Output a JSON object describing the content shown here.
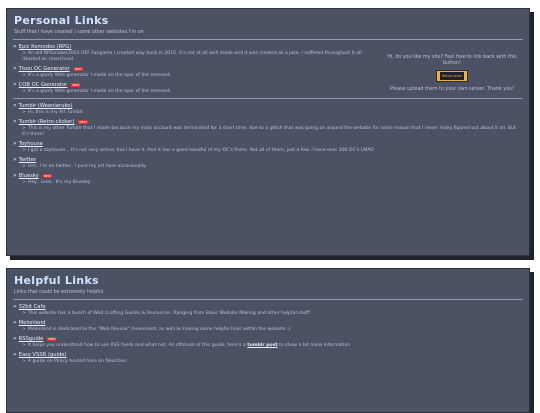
{
  "personal": {
    "title": "Personal Links",
    "subtitle": "Stuff that I have created / some other websites I'm on",
    "items": [
      {
        "label": "Epic Komodos (RPG)",
        "badge": "",
        "desc": "An old RPGmaker2003 OFF Fangame I created way back in 2015. It's not at all well made and it was created as a joke. I suffered throughout it all. (Hosted on rmarchive)"
      },
      {
        "label": "Tison OC Generator",
        "badge": "NEW",
        "desc": "It's a goofy little generator I made on the spur of the moment."
      },
      {
        "label": "COB OC Generator",
        "badge": "NEW",
        "desc": "It's a goofy little generator I made on the spur of the moment."
      },
      {
        "label": "Tumblr (Weenieruko)",
        "badge": "",
        "desc": "Hi, this is my Art Tumblr."
      },
      {
        "label": "Tumblr (Retro-clicker)",
        "badge": "NEW",
        "desc": "This is my other Tumblr that I made because my main account was terminated for a short time, due to a glitch that was going on around the website for some reason that I never really figured out about it all. But it's there!"
      },
      {
        "label": "Toyhouse",
        "badge": "",
        "desc": "I got a toyhouse... It's not very active, but I have it. And it has a good handful of my OC's there. Not all of them, just a few. I have over 300 OC's LMAO"
      },
      {
        "label": "Twitter",
        "badge": "",
        "desc": "Um.. I'm on twitter.. I post my art here occasionally."
      },
      {
        "label": "Bluesky",
        "badge": "NEW",
        "desc": "Hey.. Look.. It's my Bluesky"
      }
    ],
    "cta_top": "Hi, do you like my site? Feel free to link back with this button!",
    "banner_text": "Retroclicker",
    "cta_bottom": "Please upload them to your own server. Thank you!"
  },
  "helpful": {
    "title": "Helpful Links",
    "subtitle": "Links that could be extremely helpful",
    "items": [
      {
        "label": "32bit Cafe",
        "badge": "",
        "desc": "This website has a bunch of Web Crafting Guides & Resources. Ranging from Basic Website Making and other helpful stuff!",
        "link": ""
      },
      {
        "label": "Melonland",
        "badge": "",
        "desc": "Melonland is dedicated to the \"Web Revival\" movement, as well as having some helpful links within the website :)",
        "link": ""
      },
      {
        "label": "RSSguide",
        "badge": "NEW",
        "desc": "It helps you understand how to use RSS feeds and what not. An offshoot of this guide, here's a",
        "link": "tumblr post",
        "desc_after": "to show a bit more information"
      },
      {
        "label": "Easy VSSR (guide)",
        "badge": "",
        "desc": "A guide on Piracy hosted here on Neocities",
        "link": ""
      }
    ]
  }
}
